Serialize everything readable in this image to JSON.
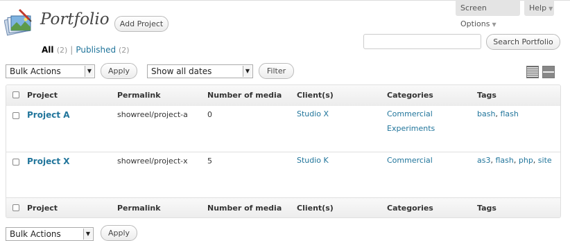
{
  "header": {
    "title": "Portfolio",
    "add_button": "Add Project",
    "screen_options": "Screen Options",
    "help": "Help"
  },
  "search": {
    "value": "",
    "button": "Search Portfolio"
  },
  "views": {
    "all_label": "All",
    "all_count": "(2)",
    "published_label": "Published",
    "published_count": "(2)",
    "separator": "|"
  },
  "actions": {
    "bulk_actions": "Bulk Actions",
    "apply": "Apply",
    "dates": "Show all dates",
    "filter": "Filter"
  },
  "columns": [
    "Project",
    "Permalink",
    "Number of media",
    "Client(s)",
    "Categories",
    "Tags"
  ],
  "rows": [
    {
      "project": "Project A",
      "permalink": "showreel/project-a",
      "media": "0",
      "client": "Studio X",
      "categories": [
        "Commercial",
        "Experiments"
      ],
      "tags": [
        "bash",
        "flash"
      ]
    },
    {
      "project": "Project X",
      "permalink": "showreel/project-x",
      "media": "5",
      "client": "Studio K",
      "categories": [
        "Commercial"
      ],
      "tags": [
        "as3",
        "flash",
        "php",
        "site"
      ]
    }
  ],
  "icons": {
    "page": "portfolio-icon",
    "list_view": "list-view-icon",
    "excerpt_view": "excerpt-view-icon"
  },
  "colors": {
    "link": "#21759b",
    "header_bg": "#ececec"
  }
}
